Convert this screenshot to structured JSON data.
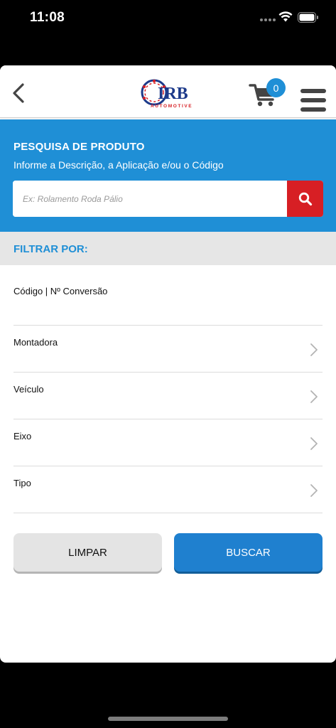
{
  "status_bar": {
    "time": "11:08"
  },
  "header": {
    "logo_text": "IRB",
    "logo_subtext": "AUTOMOTIVE",
    "cart_count": "0"
  },
  "search": {
    "title": "PESQUISA DE PRODUTO",
    "subtitle": "Informe a Descrição, a Aplicação e/ou o Código",
    "placeholder": "Ex: Rolamento Roda Pálio"
  },
  "filters": {
    "header": "FILTRAR POR:",
    "items": [
      {
        "label": "Código | Nº Conversão"
      },
      {
        "label": "Montadora"
      },
      {
        "label": "Veículo"
      },
      {
        "label": "Eixo"
      },
      {
        "label": "Tipo"
      }
    ]
  },
  "actions": {
    "clear_label": "LIMPAR",
    "search_label": "BUSCAR"
  },
  "colors": {
    "primary_blue": "#1f8fd6",
    "search_button_red": "#d71f24",
    "filter_header_bg": "#e6e6e6"
  }
}
